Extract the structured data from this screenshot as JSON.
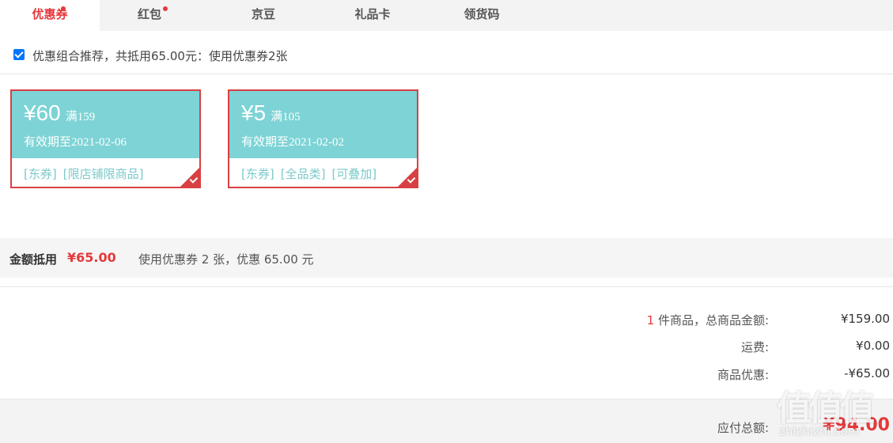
{
  "tabs": [
    {
      "label": "优惠券",
      "active": true,
      "dot": true
    },
    {
      "label": "红包",
      "active": false,
      "dot": true
    },
    {
      "label": "京豆",
      "active": false,
      "dot": false
    },
    {
      "label": "礼品卡",
      "active": false,
      "dot": false
    },
    {
      "label": "领货码",
      "active": false,
      "dot": false
    }
  ],
  "recommend": {
    "checked": true,
    "text": "优惠组合推荐，共抵用65.00元：使用优惠券2张"
  },
  "coupons": [
    {
      "amount": "¥60",
      "condition": "满159",
      "validity": "有效期至2021-02-06",
      "tags": [
        "[东券]",
        "[限店铺限商品]"
      ],
      "selected": true
    },
    {
      "amount": "¥5",
      "condition": "满105",
      "validity": "有效期至2021-02-02",
      "tags": [
        "[东券]",
        "[全品类]",
        "[可叠加]"
      ],
      "selected": true
    }
  ],
  "summary": {
    "label": "金额抵用",
    "amount": "¥65.00",
    "description": "使用优惠券 2 张，优惠 65.00 元"
  },
  "totals": {
    "items_count": "1",
    "items_label": " 件商品，总商品金额:",
    "items_value": "¥159.00",
    "shipping_label": "运费:",
    "shipping_value": "¥0.00",
    "discount_label": "商品优惠:",
    "discount_value": "-¥65.00",
    "payable_label": "应付总额:",
    "payable_value": "¥94.00"
  },
  "watermark": {
    "logo": "值值值",
    "text": "zhizhizhi.com"
  },
  "colors": {
    "accent_red": "#e4393c",
    "coupon_teal": "#7dd3d5",
    "coupon_border": "#d84043"
  }
}
